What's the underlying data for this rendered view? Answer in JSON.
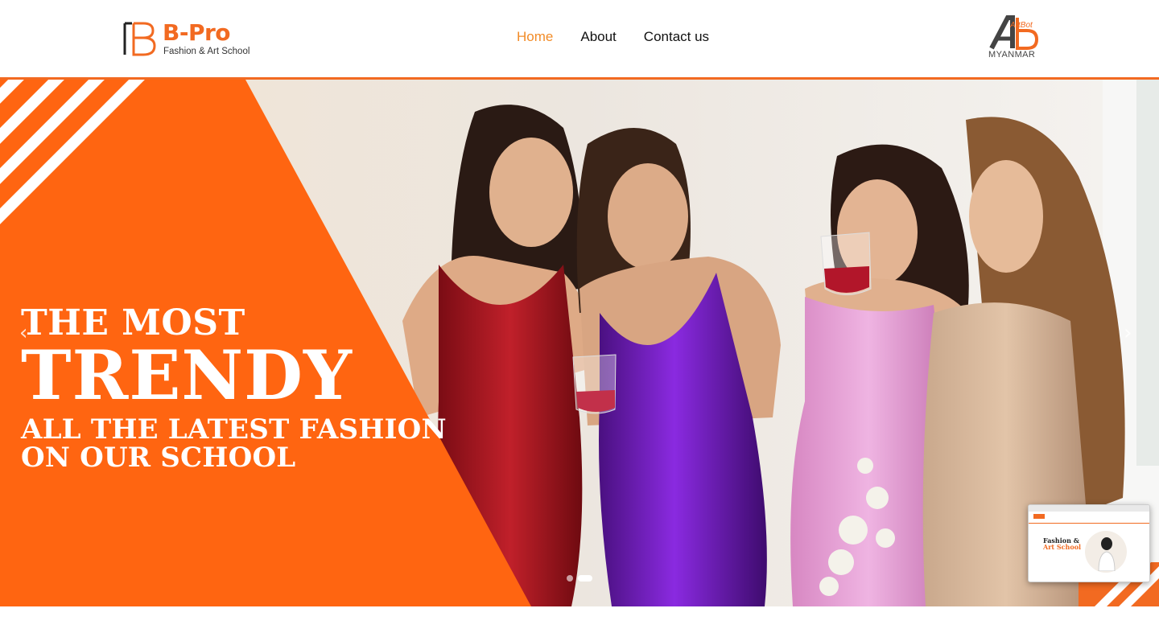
{
  "header": {
    "logo": {
      "name": "B-Pro",
      "tagline": "Fashion & Art School",
      "icon": "b-pro-logo-icon"
    },
    "nav": [
      {
        "label": "Home",
        "active": true
      },
      {
        "label": "About",
        "active": false
      },
      {
        "label": "Contact us",
        "active": false
      }
    ],
    "partner": {
      "brand": "ArtBot",
      "country": "MYANMAR",
      "icon": "artbot-logo-icon"
    }
  },
  "hero": {
    "line1": "THE MOST",
    "line2": "TRENDY",
    "line3": "ALL THE LATEST FASHION",
    "line4": "ON OUR SCHOOL",
    "prev_icon": "chevron-left-icon",
    "next_icon": "chevron-right-icon",
    "slides": 2,
    "active_slide": 2
  },
  "thumbnail": {
    "title_line1": "Fashion &",
    "title_line2": "Art School"
  },
  "colors": {
    "accent": "#f26a21",
    "nav_active": "#f28c28",
    "text": "#111111"
  }
}
